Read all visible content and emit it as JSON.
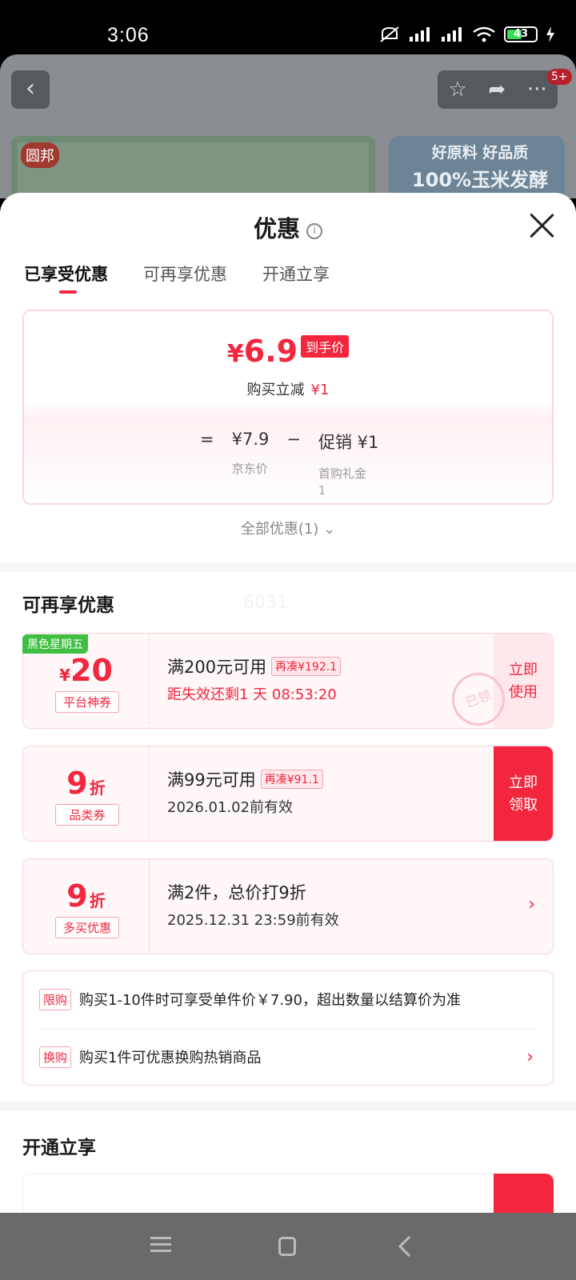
{
  "status_bar": {
    "time": "3:06",
    "battery": "43"
  },
  "background": {
    "badge": "5+",
    "logo": "圆邦",
    "banner_right_line1": "好原料 好品质",
    "banner_right_line2": "100%玉米发酵"
  },
  "sheet": {
    "title": "优惠",
    "tabs": [
      "已享受优惠",
      "可再享优惠",
      "开通立享"
    ],
    "price_card": {
      "currency": "¥",
      "final_price": "6.9",
      "final_tag": "到手价",
      "reduce_label": "购买立减",
      "reduce_value": "¥1",
      "equals": "=",
      "jd_price": "¥7.9",
      "jd_price_label": "京东价",
      "minus": "−",
      "promo": "促销 ¥1",
      "promo_sub1": "首购礼金",
      "promo_sub2": "1"
    },
    "all_offers": "全部优惠(1)",
    "section_more": "可再享优惠",
    "ghost": "6031",
    "coupons": [
      {
        "badge": "黑色星期五",
        "prefix": "¥",
        "amount": "20",
        "kind": "平台神券",
        "condition": "满200元可用",
        "tag": "再凑¥192.1",
        "expiry": "距失效还剩1 天 08:53:20",
        "button": [
          "立即",
          "使用"
        ],
        "stamp": "已领"
      },
      {
        "amount": "9",
        "unit": "折",
        "kind": "品类券",
        "condition": "满99元可用",
        "tag": "再凑¥91.1",
        "expiry": "2026.01.02前有效",
        "button": [
          "立即",
          "领取"
        ]
      },
      {
        "amount": "9",
        "unit": "折",
        "kind": "多买优惠",
        "condition": "满2件，总价打9折",
        "expiry": "2025.12.31 23:59前有效"
      }
    ],
    "limits": [
      {
        "pill": "限购",
        "text": "购买1-10件时可享受单件价￥7.90，超出数量以结算价为准"
      },
      {
        "pill": "换购",
        "text": "购买1件可优惠换购热销商品"
      }
    ],
    "section_open": "开通立享"
  },
  "colors": {
    "accent": "#f2263d",
    "badge_green": "#3fbf3f"
  }
}
